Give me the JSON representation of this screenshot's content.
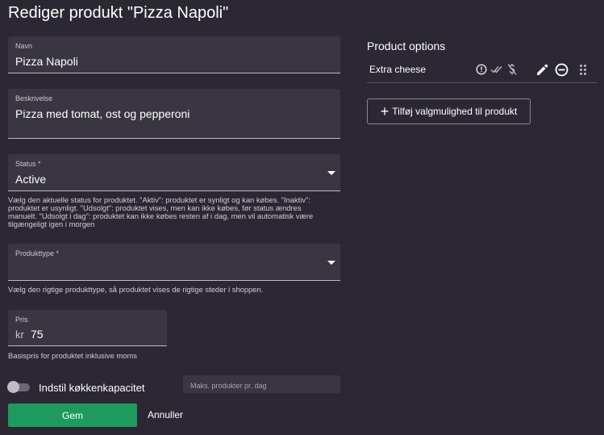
{
  "page": {
    "title": "Rediger produkt \"Pizza Napoli\""
  },
  "form": {
    "name": {
      "label": "Navn",
      "value": "Pizza Napoli"
    },
    "description": {
      "label": "Beskrivelse",
      "value": "Pizza med tomat, ost og pepperoni"
    },
    "status": {
      "label": "Status *",
      "value": "Active",
      "helper": "Vælg den aktuelle status for produktet. \"Aktiv\": produktet er synligt og kan købes. \"Inaktiv\": produktet er usynligt. \"Udsolgt\": produktet vises, men kan ikke købes, før status ændres manuelt. \"Udsolgt i dag\": produktet kan ikke købes resten af i dag, men vil automatisk være tilgængeligt igen i morgen"
    },
    "product_type": {
      "label": "Produkttype *",
      "value": "",
      "helper": "Vælg den rigtige produkttype, så produktet vises de rigtige steder i shoppen."
    },
    "price": {
      "label": "Pris",
      "prefix": "kr",
      "value": "75",
      "helper": "Basispris for produktet inklusive moms"
    },
    "kitchen_capacity": {
      "toggle_label": "Indstil køkkenkapacitet",
      "enabled": false,
      "max_placeholder": "Maks. produkter pr. dag"
    },
    "actions": {
      "save_label": "Gem",
      "cancel_label": "Annuller"
    }
  },
  "options_panel": {
    "title": "Product options",
    "items": [
      {
        "name": "Extra cheese",
        "icons": [
          "alert-circle-icon",
          "double-check-icon",
          "no-dollar-icon",
          "edit-pencil-icon",
          "remove-circle-icon",
          "drag-handle-icon"
        ]
      }
    ],
    "add_label": "Tilføj valgmulighed til produkt"
  },
  "colors": {
    "background": "#2c2833",
    "field_background": "#3a3641",
    "primary_button": "#1e9a5e"
  }
}
